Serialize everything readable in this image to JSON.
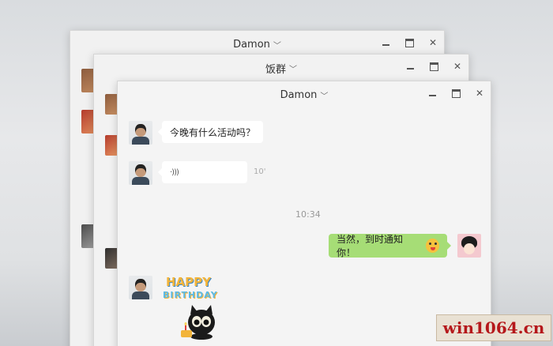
{
  "windows": {
    "back": {
      "title": "Damon"
    },
    "mid": {
      "title": "饭群"
    },
    "front": {
      "title": "Damon"
    }
  },
  "chat": {
    "messages": [
      {
        "type": "text",
        "side": "left",
        "text": "今晚有什么活动吗？"
      },
      {
        "type": "voice",
        "side": "left",
        "icon": "voice-wave-icon",
        "duration": "10'"
      },
      {
        "type": "time",
        "text": "10:34"
      },
      {
        "type": "text",
        "side": "right",
        "text": "当然，到时通知你！",
        "emoji": "wink-tongue-emoji-icon"
      },
      {
        "type": "sticker",
        "side": "left",
        "line1": "HAPPY",
        "line2": "BIRTHDAY"
      }
    ]
  },
  "watermark": {
    "text": "win1064.cn"
  },
  "colors": {
    "bubble_self": "#a6dd76",
    "bubble_other": "#ffffff",
    "window_bg": "#f4f4f4",
    "watermark_text": "#b5181b"
  }
}
